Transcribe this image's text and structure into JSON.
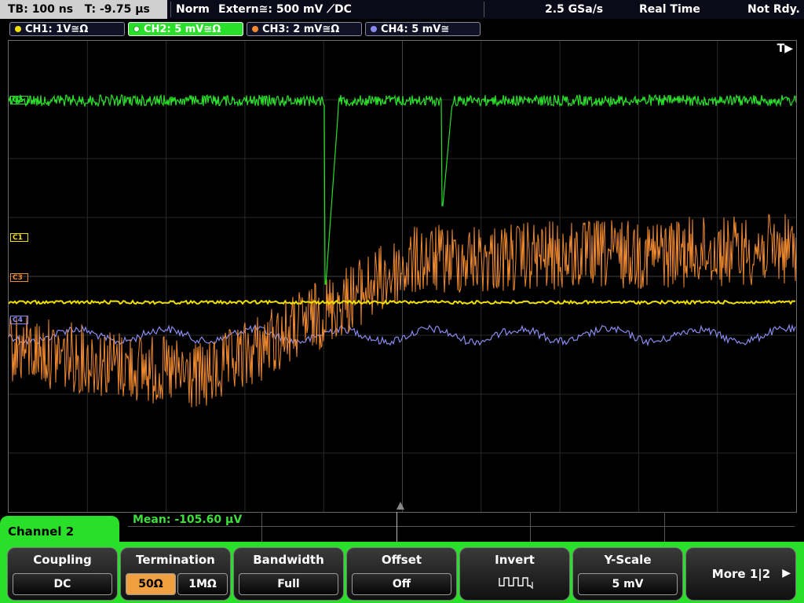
{
  "topbar": {
    "timebase": "TB: 100 ns",
    "trigger_time": "T: -9.75 µs",
    "trigger_mode": "Norm",
    "trigger_source": "Extern≅: 500 mV ⟋DC",
    "sample_rate": "2.5 GSa/s",
    "acq_mode": "Real Time",
    "status": "Not Rdy."
  },
  "channels": [
    {
      "label": "CH1: 1V≅Ω",
      "color": "#f0e000"
    },
    {
      "label": "CH2: 5 mV≅Ω",
      "color": "#2adf2a"
    },
    {
      "label": "CH3: 2 mV≅Ω",
      "color": "#f08a30"
    },
    {
      "label": "CH4: 5 mV≅",
      "color": "#8a8aee"
    }
  ],
  "scope": {
    "trigger_marker": "T▶",
    "markers": [
      "C2",
      "C1",
      "C3",
      "C4"
    ]
  },
  "measurement": {
    "label": "Mean: -105.60 µV"
  },
  "menu": {
    "title": "Channel 2",
    "coupling": {
      "title": "Coupling",
      "value": "DC"
    },
    "termination": {
      "title": "Termination",
      "opt1": "50Ω",
      "opt2": "1MΩ"
    },
    "bandwidth": {
      "title": "Bandwidth",
      "value": "Full"
    },
    "offset": {
      "title": "Offset",
      "value": "Off"
    },
    "invert": {
      "title": "Invert"
    },
    "yscale": {
      "title": "Y-Scale",
      "value": "5 mV"
    },
    "more": {
      "label": "More 1|2",
      "arrow": "▶"
    }
  }
}
